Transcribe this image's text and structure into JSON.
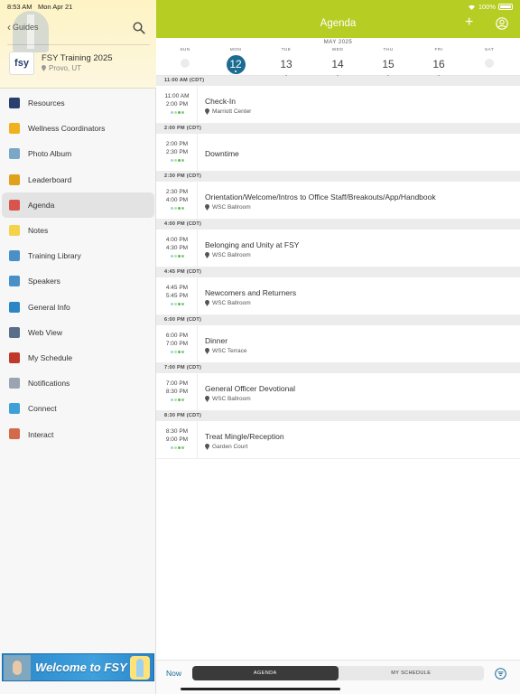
{
  "status_bar": {
    "time": "8:53 AM",
    "date": "Mon Apr 21",
    "battery": "100%"
  },
  "colors": {
    "accent_green": "#b6cd24",
    "selected_day_blue": "#1b6c93"
  },
  "sidebar": {
    "back_label": "Guides",
    "event": {
      "logo_text": "fsy",
      "name": "FSY Training 2025",
      "location": "Provo, UT"
    },
    "items": [
      {
        "label": "Resources",
        "icon": "fsy-logo-icon",
        "color": "#2a3f6e"
      },
      {
        "label": "Wellness Coordinators",
        "icon": "people-grid-icon",
        "color": "#f0b21c"
      },
      {
        "label": "Photo Album",
        "icon": "photo-icon",
        "color": "#7aa6c8"
      },
      {
        "label": "Leaderboard",
        "icon": "medal-icon",
        "color": "#e0a21a"
      },
      {
        "label": "Agenda",
        "icon": "calendar-icon",
        "color": "#d9534f"
      },
      {
        "label": "Notes",
        "icon": "notes-icon",
        "color": "#f4d34a"
      },
      {
        "label": "Training Library",
        "icon": "list-icon",
        "color": "#4a90c8"
      },
      {
        "label": "Speakers",
        "icon": "speakers-icon",
        "color": "#4a90c8"
      },
      {
        "label": "General Info",
        "icon": "info-icon",
        "color": "#2b86c5"
      },
      {
        "label": "Web View",
        "icon": "web-icon",
        "color": "#5a6e8a"
      },
      {
        "label": "My Schedule",
        "icon": "schedule-icon",
        "color": "#c0392b"
      },
      {
        "label": "Notifications",
        "icon": "envelope-icon",
        "color": "#9aa5b1"
      },
      {
        "label": "Connect",
        "icon": "connect-icon",
        "color": "#3fa0d8"
      },
      {
        "label": "Interact",
        "icon": "interact-icon",
        "color": "#d46a4a"
      }
    ],
    "banner_text": "Welcome to FSY"
  },
  "main": {
    "title": "Agenda",
    "month_label": "MAY 2025",
    "days": [
      {
        "name": "SUN",
        "num": ""
      },
      {
        "name": "MON",
        "num": "12"
      },
      {
        "name": "TUE",
        "num": "13"
      },
      {
        "name": "WED",
        "num": "14"
      },
      {
        "name": "THU",
        "num": "15"
      },
      {
        "name": "FRI",
        "num": "16"
      },
      {
        "name": "SAT",
        "num": ""
      }
    ],
    "groups": [
      {
        "header": "11:00 AM (CDT)",
        "start": "11:00 AM",
        "end": "2:00 PM",
        "title": "Check-In",
        "location": "Marriott Center"
      },
      {
        "header": "2:00 PM (CDT)",
        "start": "2:00 PM",
        "end": "2:30 PM",
        "title": "Downtime",
        "location": ""
      },
      {
        "header": "2:30 PM (CDT)",
        "start": "2:30 PM",
        "end": "4:00 PM",
        "title": "Orientation/Welcome/Intros to Office Staff/Breakouts/App/Handbook",
        "location": "WSC Ballroom"
      },
      {
        "header": "4:00 PM (CDT)",
        "start": "4:00 PM",
        "end": "4:30 PM",
        "title": "Belonging and Unity at FSY",
        "location": "WSC Ballroom"
      },
      {
        "header": "4:45 PM (CDT)",
        "start": "4:45 PM",
        "end": "5:45 PM",
        "title": "Newcomers and Returners",
        "location": "WSC Ballroom"
      },
      {
        "header": "6:00 PM (CDT)",
        "start": "6:00 PM",
        "end": "7:00 PM",
        "title": "Dinner",
        "location": "WSC Terrace"
      },
      {
        "header": "7:00 PM (CDT)",
        "start": "7:00 PM",
        "end": "8:30 PM",
        "title": "General Officer Devotional",
        "location": "WSC Ballroom"
      },
      {
        "header": "8:30 PM (CDT)",
        "start": "8:30 PM",
        "end": "9:00 PM",
        "title": "Treat Mingle/Reception",
        "location": "Garden Court"
      }
    ],
    "bottom": {
      "now_label": "Now",
      "tab_agenda": "AGENDA",
      "tab_my_schedule": "MY SCHEDULE"
    }
  }
}
